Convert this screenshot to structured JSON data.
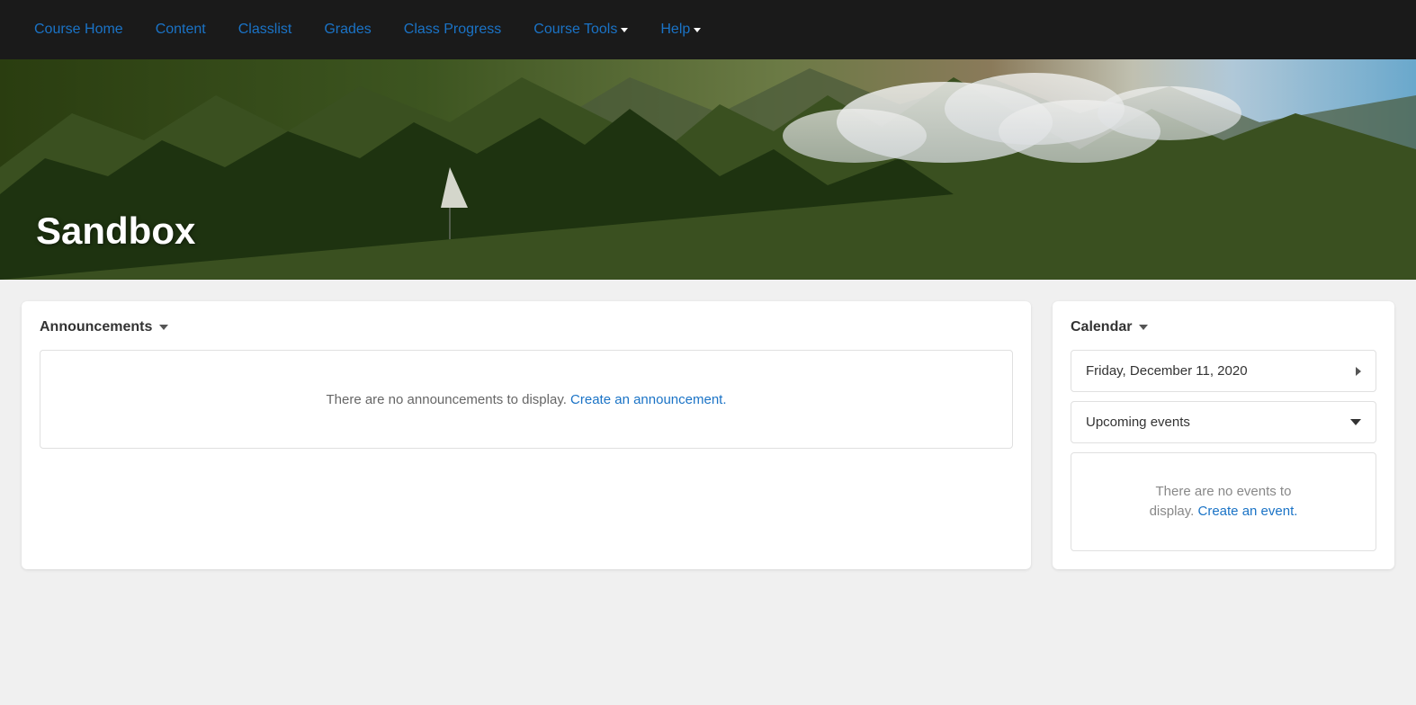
{
  "nav": {
    "items": [
      {
        "label": "Course Home",
        "active": true,
        "hasChevron": false
      },
      {
        "label": "Content",
        "active": false,
        "hasChevron": false
      },
      {
        "label": "Classlist",
        "active": false,
        "hasChevron": false
      },
      {
        "label": "Grades",
        "active": false,
        "hasChevron": false
      },
      {
        "label": "Class Progress",
        "active": false,
        "hasChevron": false
      },
      {
        "label": "Course Tools",
        "active": false,
        "hasChevron": true
      },
      {
        "label": "Help",
        "active": false,
        "hasChevron": true
      }
    ]
  },
  "hero": {
    "title": "Sandbox"
  },
  "announcements": {
    "title": "Announcements",
    "empty_text": "There are no announcements to display.",
    "link_text": "Create an announcement."
  },
  "calendar": {
    "title": "Calendar",
    "date": "Friday, December 11, 2020",
    "upcoming_label": "Upcoming events",
    "no_events_text": "There are no events to",
    "no_events_text2": "display.",
    "create_event_link": "Create an event."
  },
  "colors": {
    "link_blue": "#1a73c6",
    "nav_bg": "#1a1a1a",
    "accent": "#fff"
  }
}
